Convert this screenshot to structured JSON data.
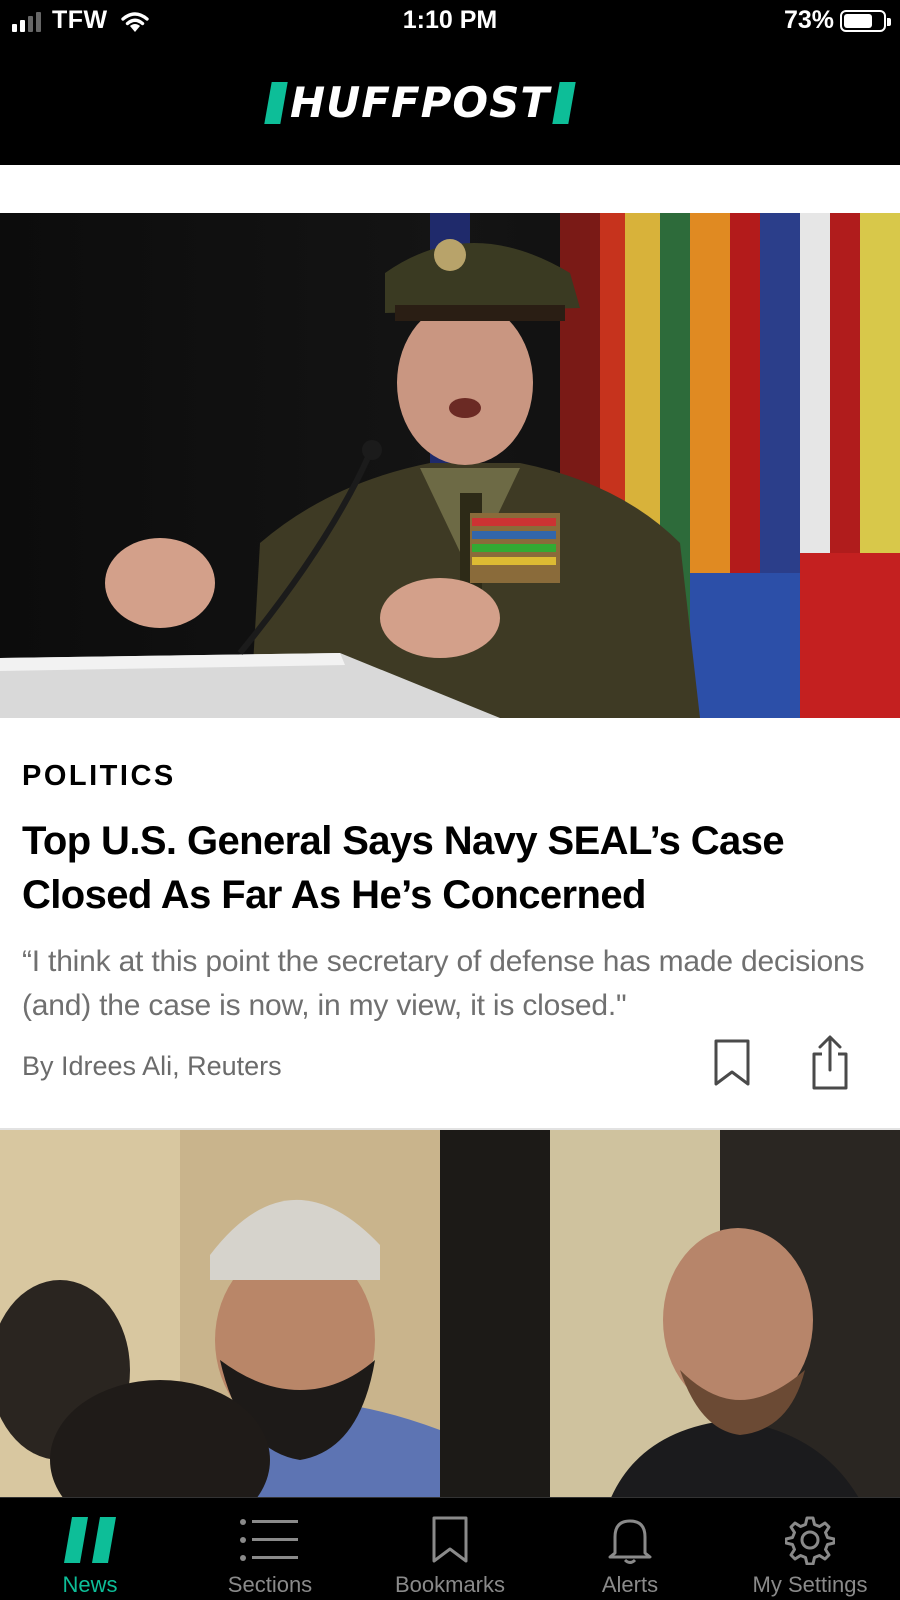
{
  "status_bar": {
    "carrier": "TFW",
    "time": "1:10 PM",
    "battery_percent": "73%",
    "battery_level": 0.73,
    "signal_bars": 2
  },
  "header": {
    "logo_text": "HUFFPOST",
    "accent_color": "#0dbe98"
  },
  "articles": [
    {
      "section": "POLITICS",
      "headline": "Top U.S. General Says Navy SEAL’s Case Closed As Far As He’s Concerned",
      "dek": "“I think at this point the secretary of defense has made decisions (and) the case is now, in my view, it is closed.\"",
      "byline": "By Idrees Ali, Reuters",
      "actions": {
        "bookmark_icon": "bookmark-icon",
        "share_icon": "share-icon"
      }
    }
  ],
  "tab_bar": {
    "items": [
      {
        "label": "News",
        "icon": "huffpost-news-icon",
        "active": true
      },
      {
        "label": "Sections",
        "icon": "list-icon",
        "active": false
      },
      {
        "label": "Bookmarks",
        "icon": "bookmark-icon",
        "active": false
      },
      {
        "label": "Alerts",
        "icon": "bell-icon",
        "active": false
      },
      {
        "label": "My Settings",
        "icon": "gear-icon",
        "active": false
      }
    ],
    "active_color": "#0dbe98",
    "inactive_color": "#8a8a8a"
  }
}
